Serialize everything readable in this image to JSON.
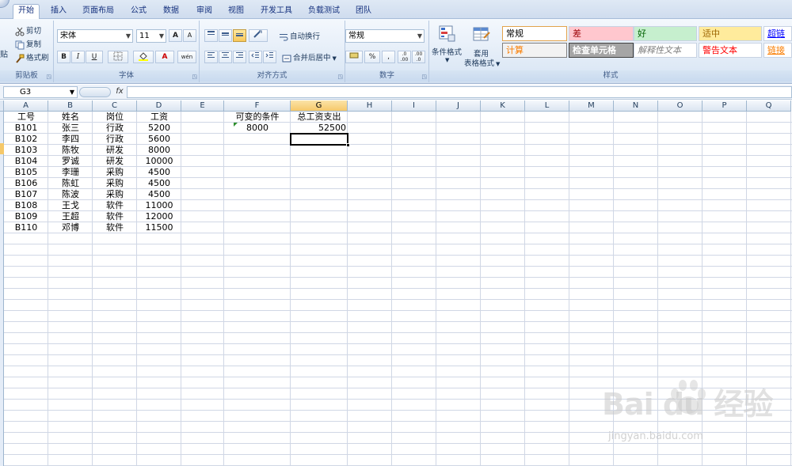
{
  "tabs": [
    {
      "label": "开始",
      "active": true
    },
    {
      "label": "插入"
    },
    {
      "label": "页面布局"
    },
    {
      "label": "公式"
    },
    {
      "label": "数据"
    },
    {
      "label": "审阅"
    },
    {
      "label": "视图"
    },
    {
      "label": "开发工具"
    },
    {
      "label": "负载测试"
    },
    {
      "label": "团队"
    }
  ],
  "ribbon": {
    "clipboard": {
      "label": "剪贴板",
      "paste": "贴",
      "cut": "剪切",
      "copy": "复制",
      "format_painter": "格式刷"
    },
    "font": {
      "label": "字体",
      "font_name": "宋体",
      "font_size": "11",
      "grow": "A",
      "shrink": "A",
      "bold": "B",
      "italic": "I",
      "underline": "U",
      "wen": "wén"
    },
    "alignment": {
      "label": "对齐方式",
      "wrap_text": "自动换行",
      "merge_center": "合并后居中"
    },
    "number": {
      "label": "数字",
      "format": "常规",
      "percent": "%",
      "comma": ",",
      "inc_decimal": ".0 .00",
      "dec_decimal": ".00 .0"
    },
    "styles": {
      "label": "样式",
      "conditional": "条件格式",
      "table_format_1": "套用",
      "table_format_2": "表格格式",
      "items": [
        {
          "label": "常规",
          "bg": "#ffffff",
          "fg": "#000000",
          "border": "#e2a34c"
        },
        {
          "label": "差",
          "bg": "#ffc7ce",
          "fg": "#9c0006"
        },
        {
          "label": "好",
          "bg": "#c6efce",
          "fg": "#006100"
        },
        {
          "label": "适中",
          "bg": "#ffeb9c",
          "fg": "#9c6500"
        },
        {
          "label": "超链接",
          "bg": "#ffffff",
          "fg": "#0000ff",
          "underline": true
        },
        {
          "label": "计算",
          "bg": "#f2f2f2",
          "fg": "#fa7d00",
          "border": "#7f7f7f"
        },
        {
          "label": "检查单元格",
          "bg": "#a5a5a5",
          "fg": "#ffffff",
          "border": "#3f3f3f",
          "bold": true
        },
        {
          "label": "解释性文本",
          "bg": "#ffffff",
          "fg": "#7f7f7f",
          "italic": true
        },
        {
          "label": "警告文本",
          "bg": "#ffffff",
          "fg": "#ff0000"
        },
        {
          "label": "链接单",
          "bg": "#ffffff",
          "fg": "#fa7d00",
          "underline": true
        }
      ]
    }
  },
  "formula_bar": {
    "name_box": "G3",
    "fx": "fx",
    "formula": ""
  },
  "columns": [
    "A",
    "B",
    "C",
    "D",
    "E",
    "F",
    "G",
    "H",
    "I",
    "J",
    "K",
    "L",
    "M",
    "N",
    "O",
    "P",
    "Q"
  ],
  "selected_column": "G",
  "sheet": {
    "headers": [
      "工号",
      "姓名",
      "岗位",
      "工资"
    ],
    "rows": [
      [
        "B101",
        "张三",
        "行政",
        "5200"
      ],
      [
        "B102",
        "李四",
        "行政",
        "5600"
      ],
      [
        "B103",
        "陈牧",
        "研发",
        "8000"
      ],
      [
        "B104",
        "罗诚",
        "研发",
        "10000"
      ],
      [
        "B105",
        "李珊",
        "采购",
        "4500"
      ],
      [
        "B106",
        "陈虹",
        "采购",
        "4500"
      ],
      [
        "B107",
        "陈波",
        "采购",
        "4500"
      ],
      [
        "B108",
        "王戈",
        "软件",
        "11000"
      ],
      [
        "B109",
        "王超",
        "软件",
        "12000"
      ],
      [
        "B110",
        "邓博",
        "软件",
        "11500"
      ]
    ],
    "f1": "可变的条件",
    "g1": "总工资支出",
    "f2": "8000",
    "g2": "52500"
  },
  "watermark": {
    "logo": "Bai du 经验",
    "url": "jingyan.baidu.com"
  }
}
